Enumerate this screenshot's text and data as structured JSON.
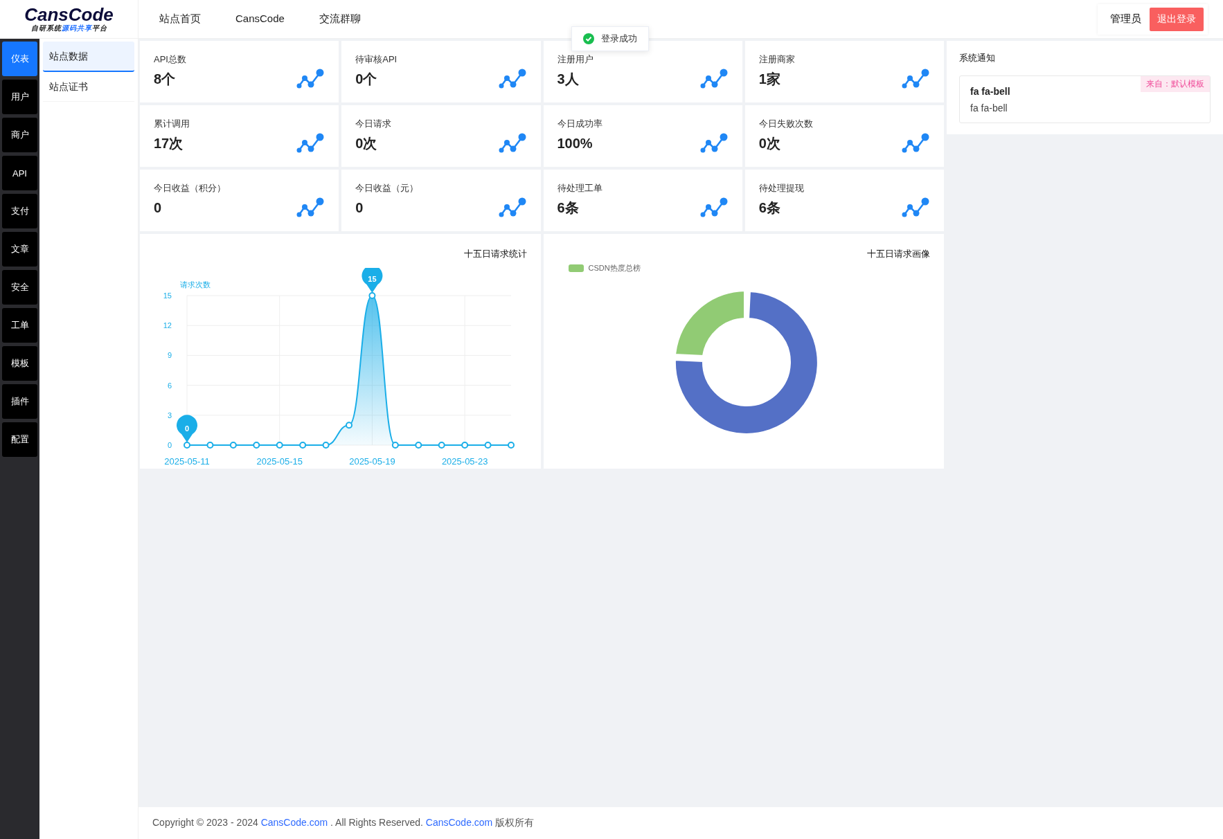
{
  "logo": {
    "title": "CansCode",
    "subtitle": [
      {
        "text": "自研系统",
        "highlight": false
      },
      {
        "text": "源码共享",
        "highlight": true
      },
      {
        "text": "平台",
        "highlight": false
      }
    ]
  },
  "top_nav": [
    {
      "label": "站点首页"
    },
    {
      "label": "CansCode"
    },
    {
      "label": "交流群聊"
    }
  ],
  "user": {
    "name": "管理员",
    "logout": "退出登录"
  },
  "toast": {
    "kind": "success",
    "text": "登录成功"
  },
  "rail": [
    {
      "label": "仪表",
      "selected": true
    },
    {
      "label": "用户",
      "selected": false
    },
    {
      "label": "商户",
      "selected": false
    },
    {
      "label": "API",
      "selected": false
    },
    {
      "label": "支付",
      "selected": false
    },
    {
      "label": "文章",
      "selected": false
    },
    {
      "label": "安全",
      "selected": false
    },
    {
      "label": "工单",
      "selected": false
    },
    {
      "label": "模板",
      "selected": false
    },
    {
      "label": "插件",
      "selected": false
    },
    {
      "label": "配置",
      "selected": false
    }
  ],
  "sub_menu": [
    {
      "label": "站点数据",
      "selected": true
    },
    {
      "label": "站点证书",
      "selected": false
    }
  ],
  "stats": [
    {
      "label": "API总数",
      "value": "8个"
    },
    {
      "label": "待审核API",
      "value": "0个"
    },
    {
      "label": "注册用户",
      "value": "3人"
    },
    {
      "label": "注册商家",
      "value": "1家"
    },
    {
      "label": "累计调用",
      "value": "17次"
    },
    {
      "label": "今日请求",
      "value": "0次"
    },
    {
      "label": "今日成功率",
      "value": "100%"
    },
    {
      "label": "今日失败次数",
      "value": "0次"
    },
    {
      "label": "今日收益（积分）",
      "value": "0"
    },
    {
      "label": "今日收益（元）",
      "value": "0"
    },
    {
      "label": "待处理工单",
      "value": "6条"
    },
    {
      "label": "待处理提现",
      "value": "6条"
    }
  ],
  "notice": {
    "title": "系统通知",
    "items": [
      {
        "title": "fa fa-bell",
        "body": "fa fa-bell",
        "tag": "来自：默认模板"
      }
    ]
  },
  "line_panel": {
    "chart_data": {
      "type": "area",
      "title": "十五日请求统计",
      "ylabel": "请求次数",
      "x": [
        "2025-05-11",
        "2025-05-12",
        "2025-05-13",
        "2025-05-14",
        "2025-05-15",
        "2025-05-16",
        "2025-05-17",
        "2025-05-18",
        "2025-05-19",
        "2025-05-20",
        "2025-05-21",
        "2025-05-22",
        "2025-05-23",
        "2025-05-24",
        "2025-05-25"
      ],
      "series": [
        {
          "color": "#1aaee8",
          "values": [
            0,
            0,
            0,
            0,
            0,
            0,
            0,
            2,
            15,
            0,
            0,
            0,
            0,
            0,
            0
          ]
        }
      ],
      "xlim": [
        "2025-05-11",
        "2025-05-25"
      ],
      "ylim": [
        0,
        15
      ],
      "yticks": [
        0,
        3,
        6,
        9,
        12,
        15
      ],
      "xticks": [
        "2025-05-11",
        "2025-05-15",
        "2025-05-19",
        "2025-05-23"
      ],
      "grid": true,
      "annotations": [
        {
          "x": "2025-05-19",
          "y": 15,
          "text": "15"
        },
        {
          "x": "2025-05-11",
          "y": 0,
          "text": "0"
        }
      ]
    }
  },
  "donut_panel": {
    "title": "十五日请求画像",
    "legend": [
      {
        "label": "CSDN热度总榜",
        "color": "#91cb74"
      }
    ]
  },
  "footer": [
    {
      "kind": "text",
      "text": "Copyright © 2023 - 2024 "
    },
    {
      "kind": "link",
      "text": "CansCode.com"
    },
    {
      "kind": "text",
      "text": " . All Rights Reserved. "
    },
    {
      "kind": "link",
      "text": "CansCode.com"
    },
    {
      "kind": "text",
      "text": " 版权所有"
    }
  ]
}
